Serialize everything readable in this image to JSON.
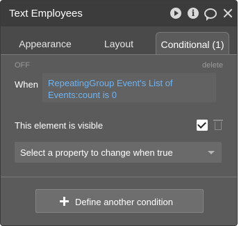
{
  "panel": {
    "title": "Text Employees",
    "header_icons": [
      "play-icon",
      "info-icon",
      "comment-icon",
      "close-icon"
    ]
  },
  "tabs": [
    {
      "label": "Appearance",
      "active": false
    },
    {
      "label": "Layout",
      "active": false
    },
    {
      "label": "Conditional (1)",
      "active": true
    }
  ],
  "condition": {
    "status": "OFF",
    "delete_label": "delete",
    "when_label": "When",
    "expression": "RepeatingGroup Event's List of Events:count is 0",
    "property_label": "This element is visible",
    "property_checked": true,
    "select_placeholder": "Select a property to change when true"
  },
  "footer": {
    "define_label": "Define another condition"
  },
  "colors": {
    "expression_text": "#6fb3f2",
    "panel_bg": "#5b5b5b",
    "titlebar_bg": "#3c3c3c"
  }
}
